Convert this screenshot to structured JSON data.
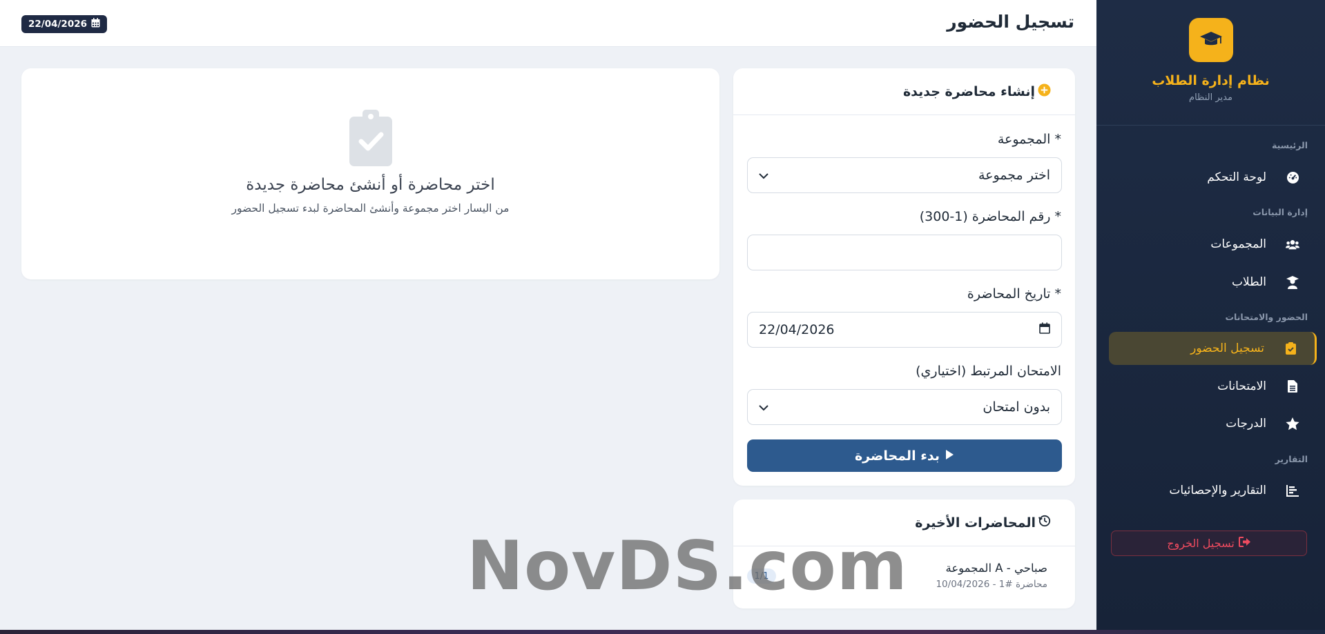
{
  "topbar": {
    "title": "تسجيل الحضور",
    "date": "22/04/2026"
  },
  "sidebar": {
    "brand_title": "نظام إدارة الطلاب",
    "brand_role": "مدير النظام",
    "sections": {
      "main": "الرئيسية",
      "data": "إدارة البيانات",
      "attendance": "الحضور والامتحانات",
      "reports": "التقارير"
    },
    "items": {
      "dashboard": "لوحة التحكم",
      "groups": "المجموعات",
      "students": "الطلاب",
      "attendance": "تسجيل الحضور",
      "exams": "الامتحانات",
      "grades": "الدرجات",
      "reports": "التقارير والإحصائيات"
    },
    "logout": "تسجيل الخروج"
  },
  "create_form": {
    "title": "إنشاء محاضرة جديدة",
    "group_label": "المجموعة *",
    "group_value": "اختر مجموعة",
    "lecture_no_label": "رقم المحاضرة (1-300) *",
    "lecture_no_value": "",
    "date_label": "تاريخ المحاضرة *",
    "date_value": "22/04/2026",
    "exam_label": "الامتحان المرتبط (اختياري)",
    "exam_value": "بدون امتحان",
    "start_button": "بدء المحاضرة"
  },
  "empty_state": {
    "title": "اختر محاضرة أو أنشئ محاضرة جديدة",
    "subtitle": "من اليسار اختر مجموعة وأنشئ المحاضرة لبدء تسجيل الحضور"
  },
  "recent": {
    "title": "المحاضرات الأخيرة",
    "items": [
      {
        "title": "المجموعة A - صباحي",
        "subtitle": "محاضرة #1 - 10/04/2026",
        "badge": "1/1"
      }
    ]
  },
  "watermark": "NovDS.com",
  "colors": {
    "accent": "#f5b21b",
    "primary": "#2d5a8e",
    "sidebar": "#1e2c45",
    "danger": "#ef4b5f"
  }
}
